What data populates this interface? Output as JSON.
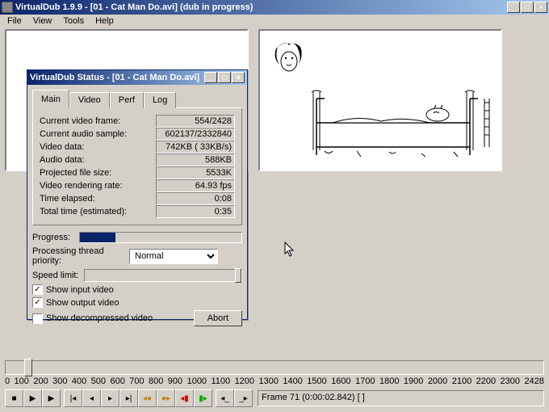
{
  "window": {
    "title": "VirtualDub 1.9.9 - [01 - Cat Man Do.avi] (dub in progress)"
  },
  "menu": {
    "file": "File",
    "view": "View",
    "tools": "Tools",
    "help": "Help"
  },
  "dlg": {
    "title": "VirtualDub Status - [01 - Cat Man Do.avi]",
    "tabs": {
      "main": "Main",
      "video": "Video",
      "perf": "Perf",
      "log": "Log"
    },
    "stats": {
      "cur_video_frame_label": "Current video frame:",
      "cur_video_frame": "554/2428",
      "cur_audio_sample_label": "Current audio sample:",
      "cur_audio_sample": "602137/2332840",
      "video_data_label": "Video data:",
      "video_data": "742KB ( 33KB/s)",
      "audio_data_label": "Audio data:",
      "audio_data": "588KB",
      "projected_label": "Projected file size:",
      "projected": "5533K",
      "render_rate_label": "Video rendering rate:",
      "render_rate": "64.93 fps",
      "time_elapsed_label": "Time elapsed:",
      "time_elapsed": "0:08",
      "total_time_label": "Total time (estimated):",
      "total_time": "0:35"
    },
    "progress_label": "Progress:",
    "priority_label": "Processing thread priority:",
    "priority_value": "Normal",
    "speed_label": "Speed limit:",
    "chk_input": "Show input video",
    "chk_output": "Show output video",
    "chk_decomp": "Show decompressed video",
    "abort": "Abort"
  },
  "timeline": {
    "ticks": [
      "0",
      "100",
      "200",
      "300",
      "400",
      "500",
      "600",
      "700",
      "800",
      "900",
      "1000",
      "1100",
      "1200",
      "1300",
      "1400",
      "1500",
      "1600",
      "1700",
      "1800",
      "1900",
      "2000",
      "2100",
      "2200",
      "2300",
      "2428"
    ]
  },
  "frame_info": "Frame 71 (0:00:02.842) [ ]",
  "winbtns": {
    "min": "_",
    "max": "□",
    "close": "×"
  }
}
